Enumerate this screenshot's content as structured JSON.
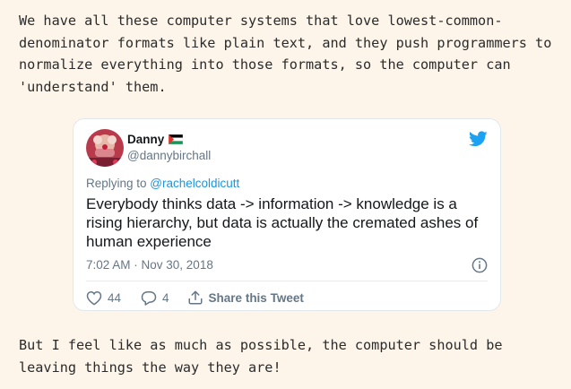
{
  "post": {
    "paragraph_1": "We have all these computer systems that love lowest-common-denominator formats like plain text, and they push programmers to normalize everything into those formats, so the computer can 'understand' them.",
    "paragraph_2": "But I feel like as much as possible, the computer should be leaving things the way they are!"
  },
  "tweet": {
    "author_name": "Danny",
    "author_handle": "@dannybirchall",
    "replying_prefix": "Replying to ",
    "replying_to": "@rachelcoldicutt",
    "text": "Everybody thinks data -> information -> knowledge is a rising hierarchy, but data is actually the cremated ashes of human experience",
    "timestamp": "7:02 AM · Nov 30, 2018",
    "like_count": "44",
    "reply_count": "4",
    "share_label": "Share this Tweet",
    "icons": {
      "brand": "twitter-bird-icon",
      "flag": "palestine-flag-icon",
      "info": "info-icon",
      "like": "heart-icon",
      "reply": "comment-icon",
      "share": "share-icon"
    },
    "colors": {
      "brand_blue": "#1da1f2",
      "link_blue": "#1b95e0",
      "muted_text": "#657786",
      "page_background": "#fdf5ea"
    }
  }
}
